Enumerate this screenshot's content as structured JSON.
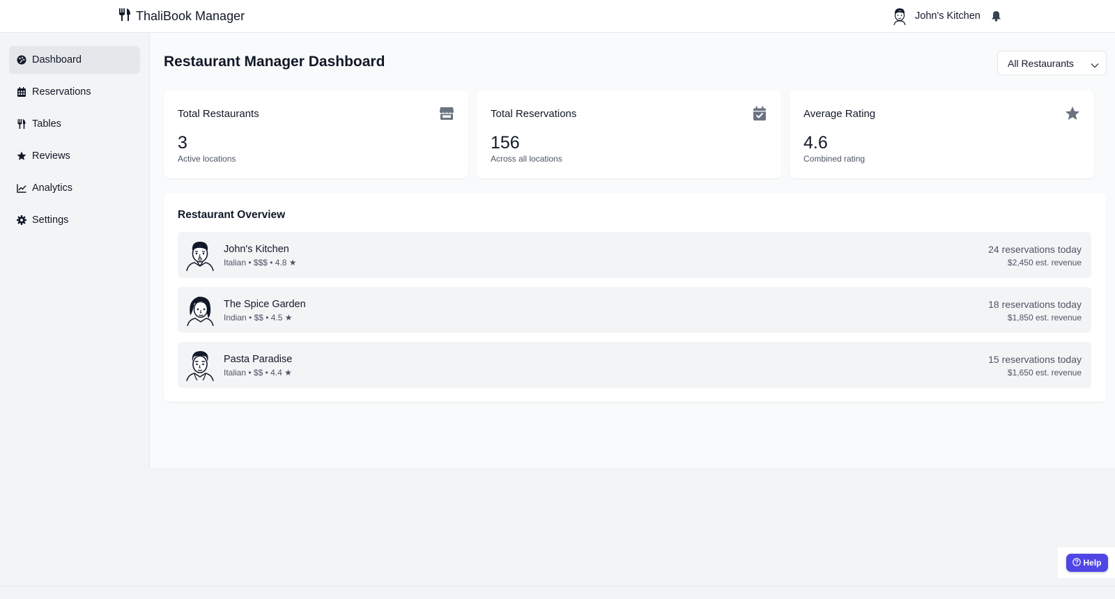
{
  "app": {
    "title": "ThaliBook Manager",
    "logo_icon": "utensils-icon"
  },
  "user": {
    "name": "John's Kitchen",
    "avatar_icon": "chef-avatar",
    "notifications_icon": "bell-icon"
  },
  "sidebar": {
    "items": [
      {
        "label": "Dashboard",
        "icon": "palette-icon",
        "active": true
      },
      {
        "label": "Reservations",
        "icon": "calendar-icon",
        "active": false
      },
      {
        "label": "Tables",
        "icon": "utensils-icon",
        "active": false
      },
      {
        "label": "Reviews",
        "icon": "star-icon",
        "active": false
      },
      {
        "label": "Analytics",
        "icon": "chart-line-icon",
        "active": false
      },
      {
        "label": "Settings",
        "icon": "gear-icon",
        "active": false
      }
    ]
  },
  "main": {
    "title": "Restaurant Manager Dashboard",
    "filter": {
      "selected": "All Restaurants"
    },
    "stats": [
      {
        "title": "Total Restaurants",
        "value": "3",
        "sub": "Active locations",
        "icon": "store-icon"
      },
      {
        "title": "Total Reservations",
        "value": "156",
        "sub": "Across all locations",
        "icon": "calendar-check-icon"
      },
      {
        "title": "Average Rating",
        "value": "4.6",
        "sub": "Combined rating",
        "icon": "star-icon"
      }
    ],
    "overview": {
      "title": "Restaurant Overview",
      "restaurants": [
        {
          "name": "John's Kitchen",
          "meta": "Italian • $$$ • 4.8 ★",
          "reservations": "24 reservations today",
          "revenue": "$2,450 est. revenue"
        },
        {
          "name": "The Spice Garden",
          "meta": "Indian • $$ • 4.5 ★",
          "reservations": "18 reservations today",
          "revenue": "$1,850 est. revenue"
        },
        {
          "name": "Pasta Paradise",
          "meta": "Italian • $$ • 4.4 ★",
          "reservations": "15 reservations today",
          "revenue": "$1,650 est. revenue"
        }
      ]
    }
  },
  "help": {
    "label": "Help",
    "icon": "question-circle-icon"
  },
  "colors": {
    "accent": "#4f46e5",
    "icon_gray": "#6b7280",
    "text": "#111827"
  }
}
